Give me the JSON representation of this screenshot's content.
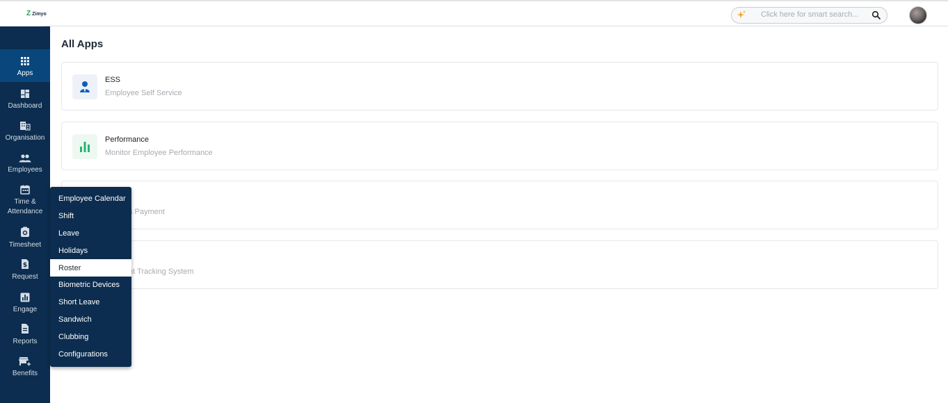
{
  "app": {
    "logo_text": "Zimyo"
  },
  "header": {
    "search_placeholder": "Click here for smart search...",
    "colors": {
      "border": "#c9cdd2",
      "spark": "#f5a623"
    }
  },
  "sidebar": {
    "items": [
      {
        "label": "Apps",
        "icon": "apps-grid-icon",
        "active": true
      },
      {
        "label": "Dashboard",
        "icon": "dashboard-icon"
      },
      {
        "label": "Organisation",
        "icon": "building-icon"
      },
      {
        "label": "Employees",
        "icon": "people-icon"
      },
      {
        "label": "Time & Attendance",
        "icon": "calendar-icon"
      },
      {
        "label": "Timesheet",
        "icon": "timesheet-icon"
      },
      {
        "label": "Request",
        "icon": "dollar-doc-icon"
      },
      {
        "label": "Engage",
        "icon": "chart-box-icon"
      },
      {
        "label": "Reports",
        "icon": "document-icon"
      },
      {
        "label": "Benefits",
        "icon": "store-icon"
      }
    ],
    "colors": {
      "bg": "#0c2d4f",
      "active": "#08467c"
    }
  },
  "main": {
    "title": "All Apps",
    "cards": [
      {
        "title": "ESS",
        "subtitle": "Employee Self Service",
        "icon": "person-icon"
      },
      {
        "title": "Performance",
        "subtitle": "Monitor Employee Performance",
        "icon": "bar-chart-icon"
      },
      {
        "title": "",
        "subtitle": "s Payment",
        "icon": ""
      },
      {
        "title": "",
        "subtitle": "nt Tracking System",
        "icon": ""
      }
    ]
  },
  "flyout": {
    "items": [
      "Employee Calendar",
      "Shift",
      "Leave",
      "Holidays",
      "Roster",
      "Biometric Devices",
      "Short Leave",
      "Sandwich",
      "Clubbing",
      "Configurations"
    ],
    "hovered": "Roster"
  }
}
